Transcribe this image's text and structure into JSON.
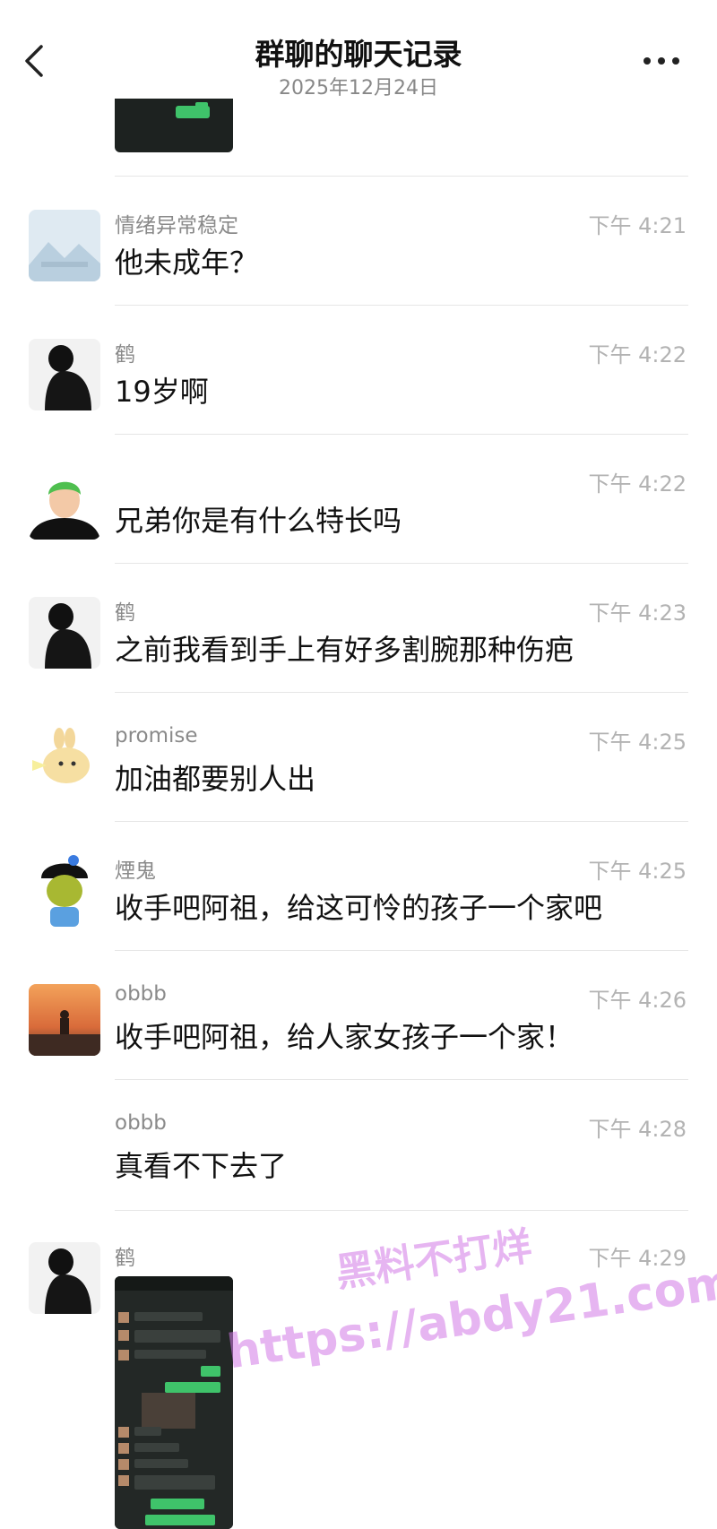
{
  "header": {
    "back_icon": "chevron-left-icon",
    "title": "群聊的聊天记录",
    "date": "2025年12月24日",
    "more_icon": "more-horizontal-icon"
  },
  "messages": [
    {
      "name": "情绪异常稳定",
      "time": "下午 4:21",
      "text": "他未成年？",
      "avatar": "landscape-placeholder"
    },
    {
      "name": "鹤",
      "time": "下午 4:22",
      "text": "19岁啊",
      "avatar": "dark-figure"
    },
    {
      "name": "",
      "time": "下午 4:22",
      "text": "兄弟你是有什么特长吗",
      "avatar": "green-hair-character"
    },
    {
      "name": "鹤",
      "time": "下午 4:23",
      "text": "之前我看到手上有好多割腕那种伤疤",
      "avatar": "dark-figure"
    },
    {
      "name": "promise",
      "time": "下午 4:25",
      "text": "加油都要别人出",
      "avatar": "cartoon-bunny"
    },
    {
      "name": "煙鬼",
      "time": "下午 4:25",
      "text": "收手吧阿祖，给这可怜的孩子一个家吧",
      "avatar": "shrek-girl"
    },
    {
      "name": "obbb",
      "time": "下午 4:26",
      "text": "收手吧阿祖，给人家女孩子一个家！",
      "avatar": "sunset-figure"
    },
    {
      "name": "obbb",
      "time": "下午 4:28",
      "text": "真看不下去了",
      "avatar": ""
    },
    {
      "name": "鹤",
      "time": "下午 4:29",
      "text": "",
      "avatar": "dark-figure"
    }
  ],
  "watermark": {
    "line1": "黑料不打烊",
    "line2": "https://abdy21.com"
  }
}
